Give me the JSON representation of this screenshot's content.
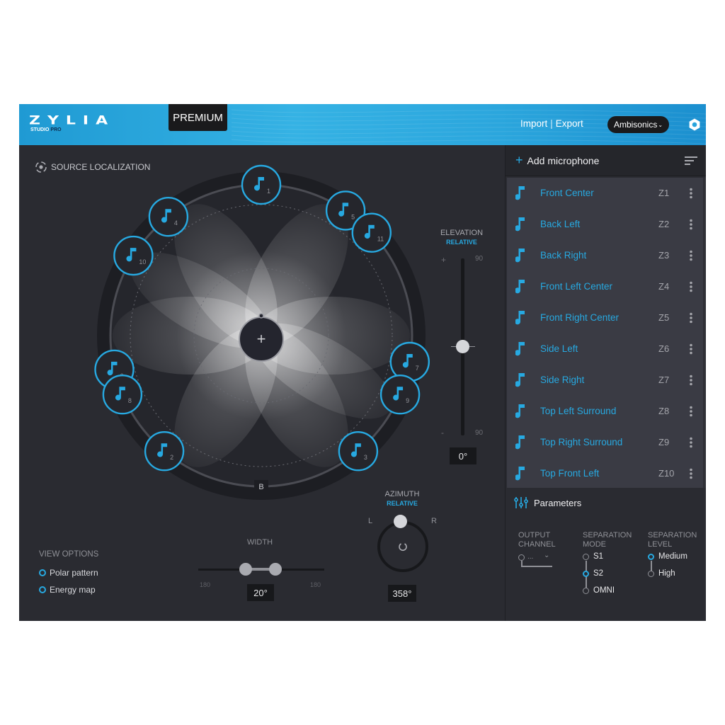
{
  "header": {
    "logo": "ZYLIA",
    "logo_sub": "STUDIO",
    "logo_sub_pro": "PRO",
    "edition_badge": "PREMIUM",
    "import_label": "Import",
    "export_label": "Export",
    "separator": "|",
    "mode_select": {
      "value": "Ambisonics",
      "icon": "chevron-down-icon"
    },
    "settings_icon": "gear-icon",
    "accent_color": "#27a9e1"
  },
  "source_localization": {
    "title": "SOURCE LOCALIZATION",
    "back_label": "B",
    "center_button": "+",
    "sources": [
      {
        "id": "1",
        "azimuth_deg": 0
      },
      {
        "id": "4",
        "azimuth_deg": -38
      },
      {
        "id": "10",
        "azimuth_deg": -58
      },
      {
        "id": "5",
        "azimuth_deg": 34
      },
      {
        "id": "11",
        "azimuth_deg": 47
      },
      {
        "id": "6",
        "azimuth_deg": -103
      },
      {
        "id": "7",
        "azimuth_deg": 100
      },
      {
        "id": "8",
        "azimuth_deg": -113
      },
      {
        "id": "9",
        "azimuth_deg": 113
      },
      {
        "id": "2",
        "azimuth_deg": -140
      },
      {
        "id": "3",
        "azimuth_deg": 140
      }
    ]
  },
  "elevation": {
    "title": "ELEVATION",
    "mode": "RELATIVE",
    "plus": "+",
    "minus": "-",
    "max": "90",
    "min": "90",
    "value": "0°",
    "position_fraction": 0.5
  },
  "azimuth": {
    "title": "AZIMUTH",
    "mode": "RELATIVE",
    "left": "L",
    "right": "R",
    "value": "358°"
  },
  "width": {
    "title": "WIDTH",
    "min": "180",
    "max": "180",
    "value": "20°"
  },
  "view_options": {
    "title": "VIEW OPTIONS",
    "items": [
      {
        "label": "Polar pattern",
        "checked": true
      },
      {
        "label": "Energy map",
        "checked": true
      }
    ]
  },
  "mic_panel": {
    "add_label": "Add microphone",
    "add_icon": "+",
    "sort_icon": "sort-icon",
    "microphones": [
      {
        "name": "Front Center",
        "zone": "Z1"
      },
      {
        "name": "Back Left",
        "zone": "Z2"
      },
      {
        "name": "Back Right",
        "zone": "Z3"
      },
      {
        "name": "Front Left Center",
        "zone": "Z4"
      },
      {
        "name": "Front Right Center",
        "zone": "Z5"
      },
      {
        "name": "Side Left",
        "zone": "Z6"
      },
      {
        "name": "Side Right",
        "zone": "Z7"
      },
      {
        "name": "Top Left Surround",
        "zone": "Z8"
      },
      {
        "name": "Top Right Surround",
        "zone": "Z9"
      },
      {
        "name": "Top Front Left",
        "zone": "Z10"
      }
    ]
  },
  "parameters": {
    "title": "Parameters",
    "output_channel": {
      "title_line1": "OUTPUT",
      "title_line2": "CHANNEL",
      "value": "..."
    },
    "separation_mode": {
      "title_line1": "SEPARATION",
      "title_line2": "MODE",
      "options": [
        "S1",
        "S2",
        "OMNI"
      ],
      "selected": "S2"
    },
    "separation_level": {
      "title_line1": "SEPARATION",
      "title_line2": "LEVEL",
      "options": [
        "Medium",
        "High"
      ],
      "selected": "Medium"
    }
  }
}
